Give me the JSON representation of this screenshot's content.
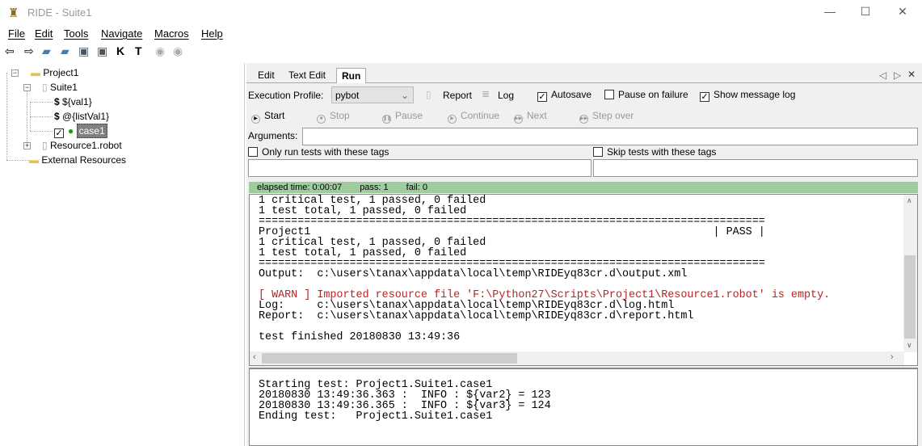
{
  "window": {
    "title": "RIDE - Suite1",
    "minimize": "—",
    "maximize": "☐",
    "close": "✕"
  },
  "menu": [
    "File",
    "Edit",
    "Tools",
    "Navigate",
    "Macros",
    "Help"
  ],
  "toolbar_icons": [
    "arrow-left-icon",
    "arrow-right-icon",
    "open-suite-icon",
    "open-folder-icon",
    "save-icon",
    "save-all-icon",
    "search-keywords-icon",
    "search-tests-icon",
    "run-icon",
    "stop-icon"
  ],
  "tree": {
    "project": "Project1",
    "suite": "Suite1",
    "var1": "${val1}",
    "var2": "@{listVal1}",
    "case": "case1",
    "resource": "Resource1.robot",
    "external": "External Resources"
  },
  "tabs": {
    "edit": "Edit",
    "text_edit": "Text Edit",
    "run": "Run",
    "active": "Run"
  },
  "run": {
    "profile_label": "Execution Profile:",
    "profile_value": "pybot",
    "report": "Report",
    "log": "Log",
    "autosave": {
      "label": "Autosave",
      "checked": true
    },
    "pause_on_failure": {
      "label": "Pause on failure",
      "checked": false
    },
    "show_message_log": {
      "label": "Show message log",
      "checked": true
    },
    "buttons": {
      "start": "Start",
      "stop": "Stop",
      "pause": "Pause",
      "continue": "Continue",
      "next": "Next",
      "step_over": "Step over"
    },
    "arguments_label": "Arguments:",
    "arguments_value": "",
    "only_tags": {
      "label": "Only run tests with these tags",
      "checked": false
    },
    "skip_tags": {
      "label": "Skip tests with these tags",
      "checked": false
    },
    "status": {
      "elapsed": "elapsed time: 0:00:07",
      "pass": "pass: 1",
      "fail": "fail: 0",
      "color": "#9fcc9f"
    }
  },
  "output_lines": [
    "1 critical test, 1 passed, 0 failed",
    "1 test total, 1 passed, 0 failed",
    "==============================================================================",
    "Project1                                                              | PASS |",
    "1 critical test, 1 passed, 0 failed",
    "1 test total, 1 passed, 0 failed",
    "==============================================================================",
    "Output:  c:\\users\\tanax\\appdata\\local\\temp\\RIDEyq83cr.d\\output.xml",
    "",
    "[ WARN ] Imported resource file 'F:\\Python27\\Scripts\\Project1\\Resource1.robot' is empty.",
    "Log:     c:\\users\\tanax\\appdata\\local\\temp\\RIDEyq83cr.d\\log.html",
    "Report:  c:\\users\\tanax\\appdata\\local\\temp\\RIDEyq83cr.d\\report.html",
    "",
    "test finished 20180830 13:49:36"
  ],
  "message_lines": [
    "Starting test: Project1.Suite1.case1",
    "20180830 13:49:36.363 :  INFO : ${var2} = 123",
    "20180830 13:49:36.365 :  INFO : ${var3} = 124",
    "Ending test:   Project1.Suite1.case1"
  ],
  "colors": {
    "warn": "#b22222",
    "selection": "#808080"
  }
}
